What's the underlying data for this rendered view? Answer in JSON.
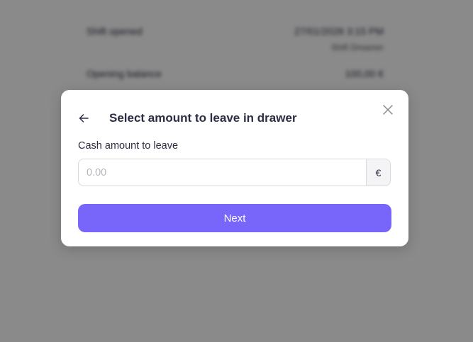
{
  "background": {
    "rows": [
      {
        "label": "Shift opened",
        "value": "27/01/2026 3:15 PM",
        "sub": "Shift Dreamer"
      },
      {
        "label": "Opening balance",
        "value": "100,00 €"
      }
    ]
  },
  "modal": {
    "title": "Select amount to leave in drawer",
    "field_label": "Cash amount to leave",
    "amount_placeholder": "0.00",
    "currency_symbol": "€",
    "next_label": "Next"
  },
  "icons": {
    "back": "arrow-left-icon",
    "close": "close-icon"
  },
  "colors": {
    "accent": "#7866fb",
    "text": "#2b2d42",
    "overlay": "rgba(0,0,0,0.46)"
  }
}
